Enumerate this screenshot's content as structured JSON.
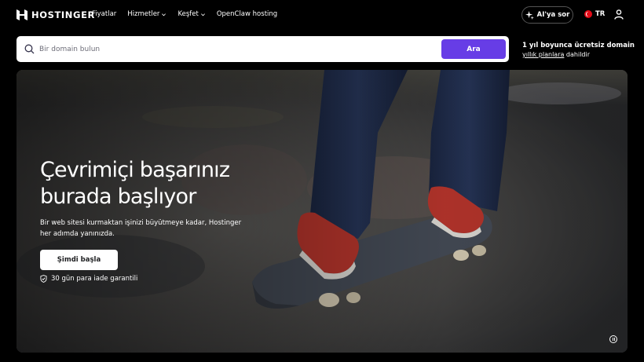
{
  "header": {
    "brand": "HOSTINGER",
    "nav": [
      {
        "label": "Fiyatlar",
        "has_dropdown": false
      },
      {
        "label": "Hizmetler",
        "has_dropdown": true
      },
      {
        "label": "Keşfet",
        "has_dropdown": true
      },
      {
        "label": "OpenClaw hosting",
        "has_dropdown": false
      }
    ],
    "ai_button": "AI'ya sor",
    "language": "TR",
    "icons": {
      "logo": "hostinger-logo-icon",
      "ai": "sparkle-icon",
      "flag": "turkey-flag-icon",
      "account": "user-icon"
    }
  },
  "search": {
    "placeholder": "Bir domain bulun",
    "value": "",
    "button_label": "Ara",
    "icon": "search-icon"
  },
  "promo": {
    "title": "1 yıl boyunca ücretsiz domain",
    "link_text": "yıllık planlara",
    "suffix": " dahildir"
  },
  "hero": {
    "title_line1": "Çevrimiçi başarınız",
    "title_line2": "burada başlıyor",
    "description": "Bir web sitesi kurmaktan işinizi büyütmeye kadar, Hostinger her adımda yanınızda.",
    "cta_label": "Şimdi başla",
    "guarantee": "30 gün para iade garantili",
    "image_subject": "skateboarder-legs-photo",
    "pause_icon": "pause-icon"
  },
  "colors": {
    "brand_purple": "#673de6",
    "background": "#000000",
    "text": "#ffffff",
    "shoe_red": "#c93a30"
  }
}
